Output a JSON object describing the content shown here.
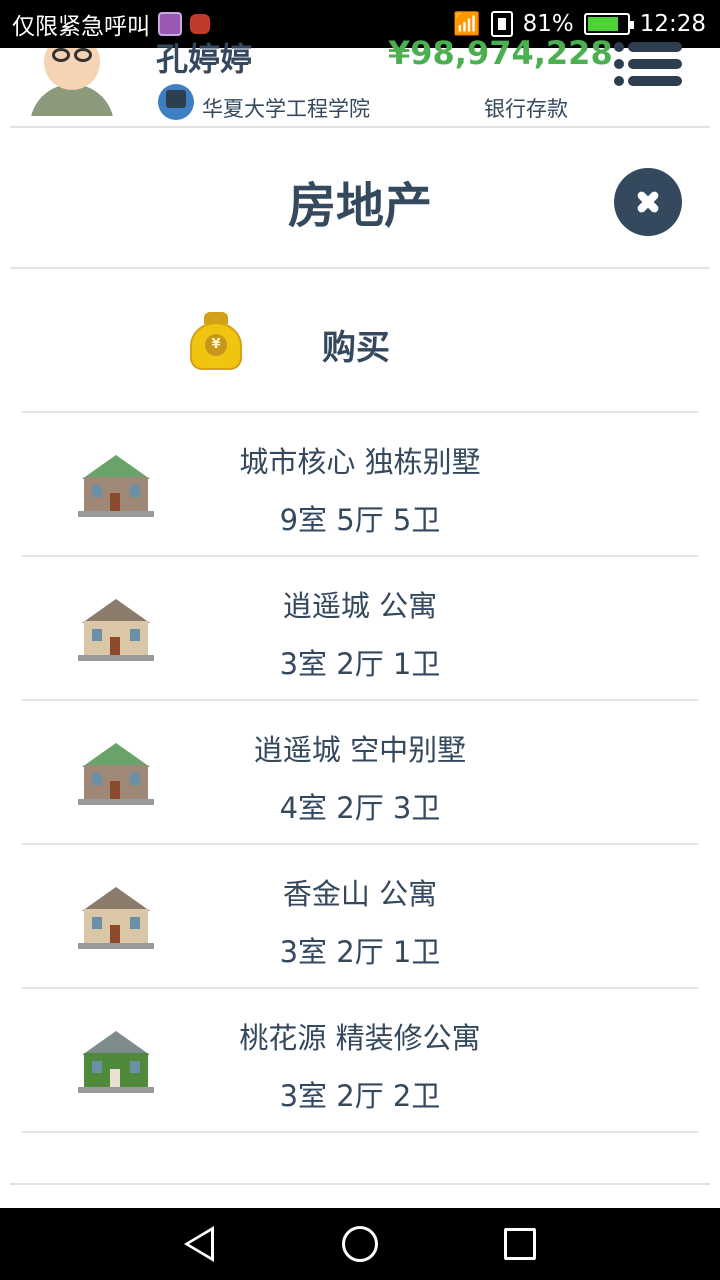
{
  "status_bar": {
    "carrier_text": "仅限紧急呼叫",
    "battery_percent": "81%",
    "time": "12:28",
    "battery_level": 0.81
  },
  "header": {
    "user_name": "孔婷婷",
    "balance": "¥98,974,228",
    "school": "华夏大学工程学院",
    "balance_label": "银行存款"
  },
  "page": {
    "title": "房地产"
  },
  "buy": {
    "label": "购买",
    "icon_symbol": "¥"
  },
  "properties": [
    {
      "name": "城市核心 独栋别墅",
      "rooms": "9室 5厅 5卫",
      "icon": "villa-house-icon"
    },
    {
      "name": "逍遥城 公寓",
      "rooms": "3室 2厅 1卫",
      "icon": "apartment-house-icon"
    },
    {
      "name": "逍遥城 空中别墅",
      "rooms": "4室 2厅 3卫",
      "icon": "villa-house-icon"
    },
    {
      "name": "香金山 公寓",
      "rooms": "3室 2厅 1卫",
      "icon": "apartment-house-icon"
    },
    {
      "name": "桃花源 精装修公寓",
      "rooms": "3室 2厅 2卫",
      "icon": "green-house-icon"
    }
  ],
  "colors": {
    "text": "#34495e",
    "balance": "#4caf50",
    "divider": "#dfe3e6"
  }
}
